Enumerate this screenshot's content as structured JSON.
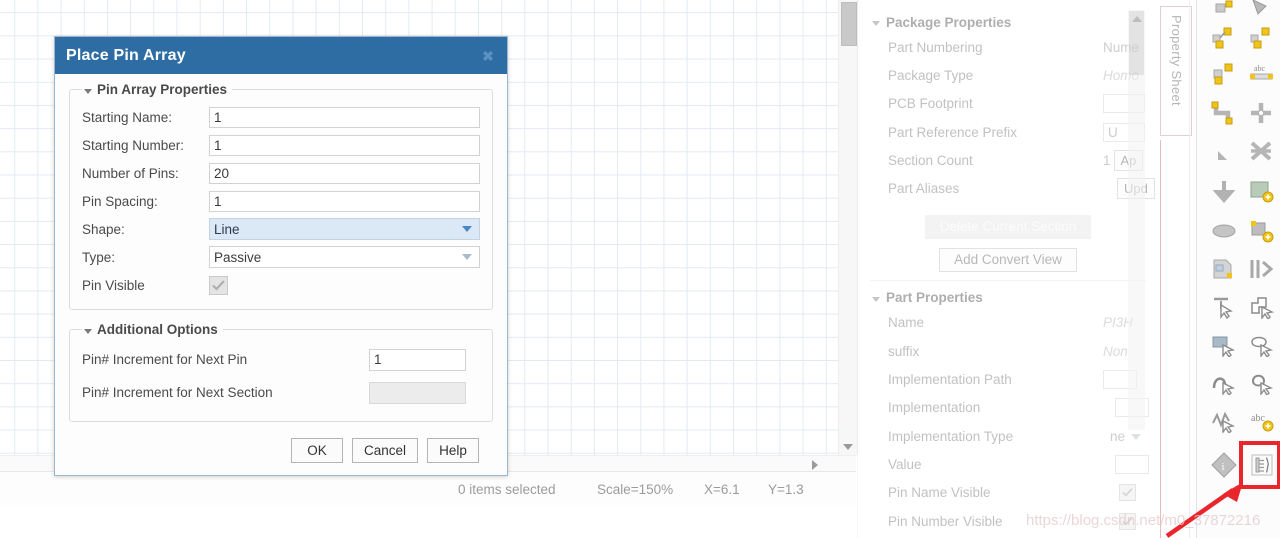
{
  "canvas": {
    "name": "schematic-canvas"
  },
  "statusbar": {
    "selection": "0 items selected",
    "scale": "Scale=150%",
    "x": "X=6.1",
    "y": "Y=1.3"
  },
  "dialog": {
    "title": "Place Pin Array",
    "close_glyph": "✖",
    "group1": {
      "legend": "Pin Array Properties",
      "fields": [
        {
          "label": "Starting Name:",
          "value": "1",
          "type": "text"
        },
        {
          "label": "Starting Number:",
          "value": "1",
          "type": "text"
        },
        {
          "label": "Number of Pins:",
          "value": "20",
          "type": "text"
        },
        {
          "label": "Pin Spacing:",
          "value": "1",
          "type": "text"
        },
        {
          "label": "Shape:",
          "value": "Line",
          "type": "combo-selected"
        },
        {
          "label": "Type:",
          "value": "Passive",
          "type": "combo"
        },
        {
          "label": "Pin Visible",
          "value": "",
          "type": "checkbox-checked-disabled"
        }
      ]
    },
    "group2": {
      "legend": "Additional Options",
      "fields": [
        {
          "label": "Pin# Increment for Next Pin",
          "value": "1",
          "type": "text"
        },
        {
          "label": "Pin# Increment for Next Section",
          "value": "",
          "type": "text-disabled"
        }
      ]
    },
    "buttons": [
      {
        "label": "OK"
      },
      {
        "label": "Cancel"
      },
      {
        "label": "Help"
      }
    ]
  },
  "property_sheet": {
    "tab_label": "Property Sheet",
    "sections": [
      {
        "title": "Package Properties",
        "rows": [
          {
            "name": "Part Numbering",
            "value": "Nume",
            "style": "plain"
          },
          {
            "name": "Package Type",
            "value": "Homo",
            "style": "italic"
          },
          {
            "name": "PCB Footprint",
            "value": "",
            "style": "box"
          },
          {
            "name": "Part Reference Prefix",
            "value": "U",
            "style": "box"
          },
          {
            "name": "Section Count",
            "value": "1",
            "value2": "Ap",
            "style": "box-plus-button"
          },
          {
            "name": "Part Aliases",
            "value": "Upd",
            "style": "button"
          }
        ],
        "buttons": [
          {
            "label": "Delete Current Section",
            "disabled": true
          },
          {
            "label": "Add Convert View",
            "disabled": false
          }
        ]
      },
      {
        "title": "Part Properties",
        "rows": [
          {
            "name": "Name",
            "value": "PI3H",
            "style": "italic"
          },
          {
            "name": "suffix",
            "value": "Non",
            "style": "italic"
          },
          {
            "name": "Implementation Path",
            "value": "",
            "style": "box"
          },
          {
            "name": "Implementation",
            "value": "",
            "style": "box"
          },
          {
            "name": "Implementation Type",
            "value": "ne",
            "style": "combo"
          },
          {
            "name": "Value",
            "value": "",
            "style": "box"
          },
          {
            "name": "Pin Name Visible",
            "value": "",
            "style": "checkbox"
          },
          {
            "name": "Pin Number Visible",
            "value": "",
            "style": "checkbox"
          }
        ]
      }
    ]
  },
  "watermark": "https://blog.csdn.net/m0_37872216",
  "colors": {
    "title_bar": "#2e6da4",
    "selected_combo": "#dbe8f6",
    "annotation_red": "#e8262c",
    "grid_line": "#e2eaf0"
  }
}
